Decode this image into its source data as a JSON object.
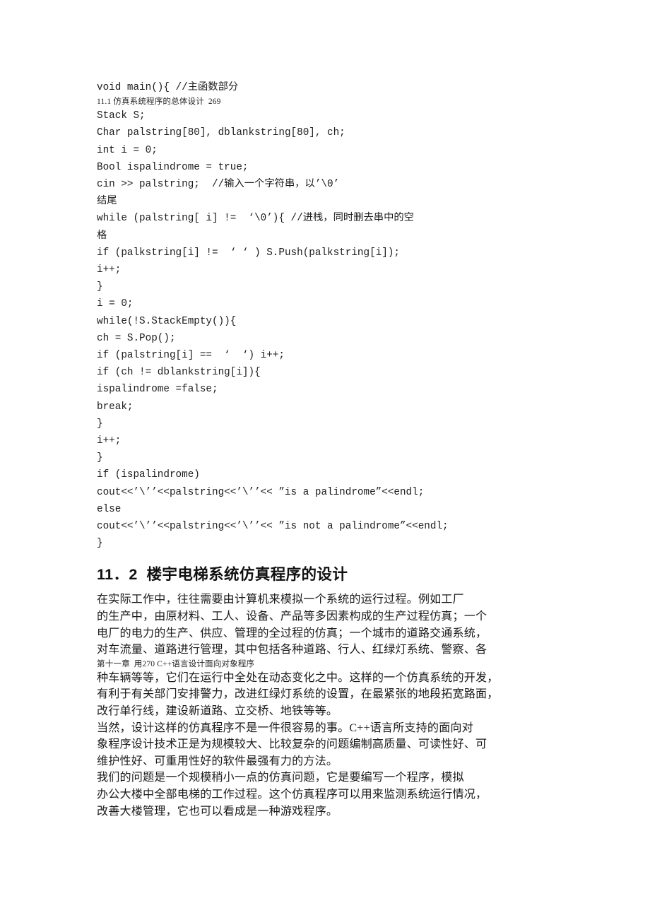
{
  "document": {
    "page_number_shown": "269",
    "language": "zh-CN",
    "background_color": "#ffffff",
    "text_color": "#1a1a1a"
  },
  "running_headers": {
    "top_artifact": "11.1 仿真系统程序的总体设计  269",
    "mid_artifact": "第十一章  用270 C++语言设计面向对象程序"
  },
  "code_listing": {
    "lines": [
      "void main(){ //主函数部分",
      "Stack S;",
      "Char palstring[80], dblankstring[80], ch;",
      "int i = 0;",
      "Bool ispalindrome = true;",
      "cin >> palstring;  //输入一个字符串，以’\\0’",
      "结尾",
      "while (palstring[ i] !=  ‘\\0’){ //进栈，同时删去串中的空",
      "格",
      "if (palkstring[i] !=  ‘ ‘ ) S.Push(palkstring[i]);",
      "i++;",
      "}",
      "i = 0;",
      "while(!S.StackEmpty()){",
      "ch = S.Pop();",
      "if (palstring[i] ==  ‘  ‘) i++;",
      "if (ch != dblankstring[i]){",
      "ispalindrome =false;",
      "break;",
      "}",
      "i++;",
      "}",
      "if (ispalindrome)",
      "cout<<’\\’’<<palstring<<’\\’’<< ”is a palindrome”<<endl;",
      "else",
      "cout<<’\\’’<<palstring<<’\\’’<< ”is not a palindrome”<<endl;",
      "}"
    ]
  },
  "section": {
    "heading": "11．2  楼宇电梯系统仿真程序的设计",
    "paragraphs": [
      {
        "id": "p1",
        "lines": [
          "在实际工作中，往往需要由计算机来模拟一个系统的运行过程。例如工厂",
          "的生产中，由原材料、工人、设备、产品等多因素构成的生产过程仿真；一个",
          "电厂的电力的生产、供应、管理的全过程的仿真；一个城市的道路交通系统，",
          "对车流量、道路进行管理，其中包括各种道路、行人、红绿灯系统、警察、各"
        ]
      },
      {
        "id": "p2",
        "lines": [
          "种车辆等等，它们在运行中全处在动态变化之中。这样的一个仿真系统的开发，",
          "有利于有关部门安排警力，改进红绿灯系统的设置，在最紧张的地段拓宽路面，",
          "改行单行线，建设新道路、立交桥、地铁等等。"
        ]
      },
      {
        "id": "p3",
        "lines": [
          "当然，设计这样的仿真程序不是一件很容易的事。C++语言所支持的面向对",
          "象程序设计技术正是为规模较大、比较复杂的问题编制高质量、可读性好、可",
          "维护性好、可重用性好的软件最强有力的方法。"
        ]
      },
      {
        "id": "p4",
        "lines": [
          "我们的问题是一个规模稍小一点的仿真问题，它是要编写一个程序，模拟",
          "办公大楼中全部电梯的工作过程。这个仿真程序可以用来监测系统运行情况，",
          "改善大楼管理，它也可以看成是一种游戏程序。"
        ]
      }
    ]
  }
}
